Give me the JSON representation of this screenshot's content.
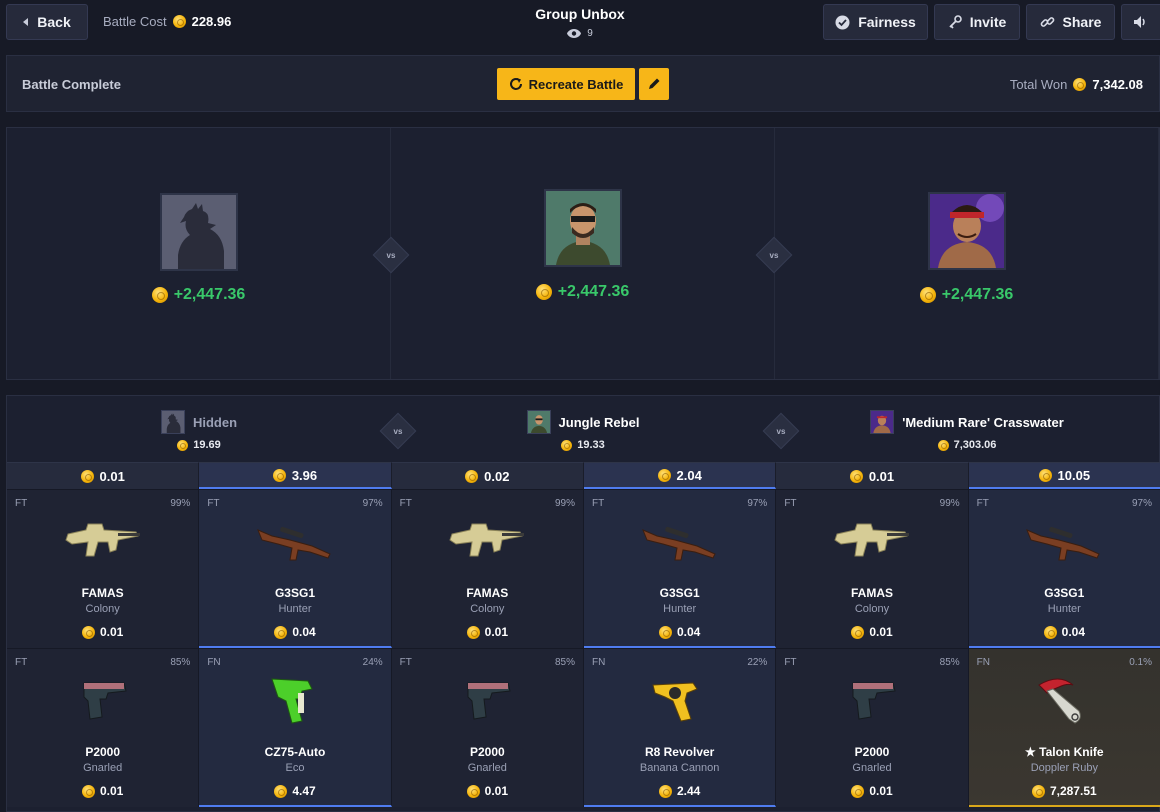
{
  "topbar": {
    "back_label": "Back",
    "battle_cost_label": "Battle Cost",
    "battle_cost_value": "228.96",
    "title": "Group Unbox",
    "viewers": "9",
    "fairness_label": "Fairness",
    "invite_label": "Invite",
    "share_label": "Share"
  },
  "status": {
    "label": "Battle Complete",
    "recreate_label": "Recreate Battle",
    "total_won_label": "Total Won",
    "total_won_value": "7,342.08"
  },
  "showcase": [
    {
      "won": "+2,447.36"
    },
    {
      "won": "+2,447.36"
    },
    {
      "won": "+2,447.36"
    }
  ],
  "vs_label": "vs",
  "players": [
    {
      "name": "Hidden",
      "total": "19.69"
    },
    {
      "name": "Jungle Rebel",
      "total": "19.33"
    },
    {
      "name": "'Medium Rare' Crasswater",
      "total": "7,303.06"
    }
  ],
  "rounds": [
    {
      "value": "0.01"
    },
    {
      "value": "3.96"
    },
    {
      "value": "0.02"
    },
    {
      "value": "2.04"
    },
    {
      "value": "0.01"
    },
    {
      "value": "10.05"
    }
  ],
  "items_row1": [
    {
      "wear": "FT",
      "chance": "99%",
      "name": "FAMAS",
      "skin": "Colony",
      "price": "0.01"
    },
    {
      "wear": "FT",
      "chance": "97%",
      "name": "G3SG1",
      "skin": "Hunter",
      "price": "0.04"
    },
    {
      "wear": "FT",
      "chance": "99%",
      "name": "FAMAS",
      "skin": "Colony",
      "price": "0.01"
    },
    {
      "wear": "FT",
      "chance": "97%",
      "name": "G3SG1",
      "skin": "Hunter",
      "price": "0.04"
    },
    {
      "wear": "FT",
      "chance": "99%",
      "name": "FAMAS",
      "skin": "Colony",
      "price": "0.01"
    },
    {
      "wear": "FT",
      "chance": "97%",
      "name": "G3SG1",
      "skin": "Hunter",
      "price": "0.04"
    }
  ],
  "items_row2": [
    {
      "wear": "FT",
      "chance": "85%",
      "name": "P2000",
      "skin": "Gnarled",
      "price": "0.01"
    },
    {
      "wear": "FN",
      "chance": "24%",
      "name": "CZ75-Auto",
      "skin": "Eco",
      "price": "4.47"
    },
    {
      "wear": "FT",
      "chance": "85%",
      "name": "P2000",
      "skin": "Gnarled",
      "price": "0.01"
    },
    {
      "wear": "FN",
      "chance": "22%",
      "name": "R8 Revolver",
      "skin": "Banana Cannon",
      "price": "2.44"
    },
    {
      "wear": "FT",
      "chance": "85%",
      "name": "P2000",
      "skin": "Gnarled",
      "price": "0.01"
    },
    {
      "wear": "FN",
      "chance": "0.1%",
      "name": "★ Talon Knife",
      "skin": "Doppler Ruby",
      "price": "7,287.51"
    }
  ],
  "colors": {
    "accent": "#f7b618",
    "win_green": "#39c86a",
    "round_win": "#4f7cf0"
  }
}
